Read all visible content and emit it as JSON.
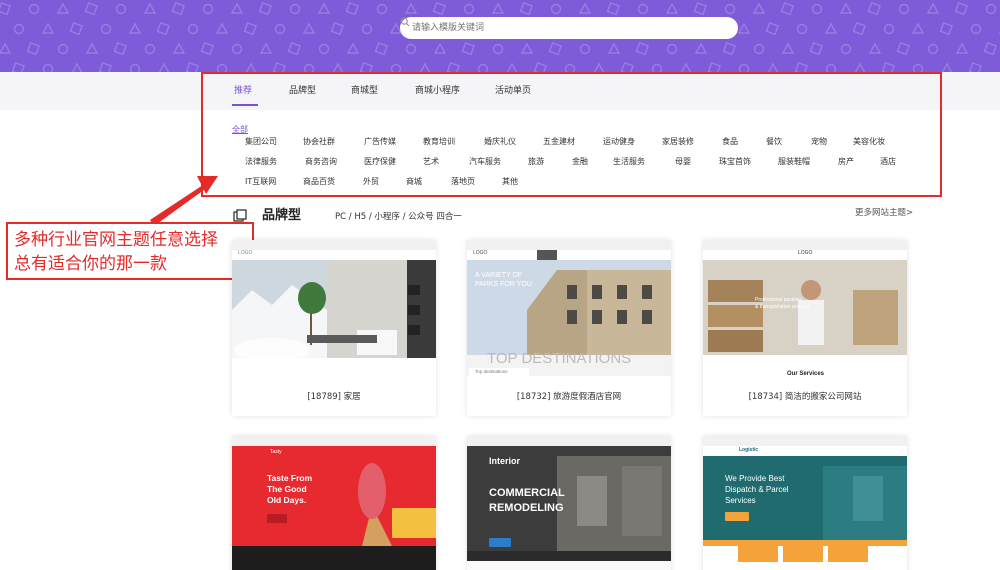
{
  "search": {
    "placeholder": "请输入模版关键词"
  },
  "tabs": [
    {
      "label": "推荐",
      "active": true
    },
    {
      "label": "品牌型",
      "active": false
    },
    {
      "label": "商城型",
      "active": false
    },
    {
      "label": "商城小程序",
      "active": false
    },
    {
      "label": "活动单页",
      "active": false
    }
  ],
  "categories": {
    "all": "全部",
    "row1": [
      "集团公司",
      "协会社群",
      "广告传媒",
      "教育培训",
      "婚庆礼仪",
      "五金建材",
      "运动健身",
      "家居装修",
      "食品",
      "餐饮",
      "宠物",
      "美容化妆"
    ],
    "row2": [
      "法律服务",
      "商务咨询",
      "医疗保健",
      "艺术",
      "汽车服务",
      "旅游",
      "金融",
      "生活服务",
      "母婴",
      "珠宝首饰",
      "服装鞋帽",
      "房产",
      "酒店"
    ],
    "row3": [
      "IT互联网",
      "商品百货",
      "外贸",
      "商城",
      "落地页",
      "其他"
    ]
  },
  "callout": {
    "line1": "多种行业官网主题任意选择",
    "line2": "总有适合你的那一款"
  },
  "section": {
    "title": "品牌型",
    "subtitle": "PC / H5 / 小程序 / 公众号 四合一",
    "more": "更多网站主题>"
  },
  "cards": [
    {
      "label": "[18789] 家居",
      "shot_text": [
        "LOGO"
      ]
    },
    {
      "label": "[18732] 旅游度假酒店官网",
      "shot_text": [
        "LOGO",
        "A VARIETY OF",
        "PARKS FOR YOU",
        "TOP DESTINATIONS",
        "Top destinations"
      ]
    },
    {
      "label": "[18734] 简洁的搬家公司网站",
      "shot_text": [
        "LOGO",
        "Professional packing",
        "& transportation services",
        "Our Services"
      ]
    },
    {
      "shot_text": [
        "Tasty",
        "Taste From",
        "The Good",
        "Old Days."
      ]
    },
    {
      "shot_text": [
        "Interior",
        "COMMERCIAL",
        "REMODELING"
      ]
    },
    {
      "shot_text": [
        "Logistic",
        "We Provide Best",
        "Dispatch & Parcel",
        "Services"
      ]
    }
  ],
  "colors": {
    "accent": "#7a52d6",
    "banner": "#7e5bd8",
    "highlight": "#e52a2a"
  }
}
